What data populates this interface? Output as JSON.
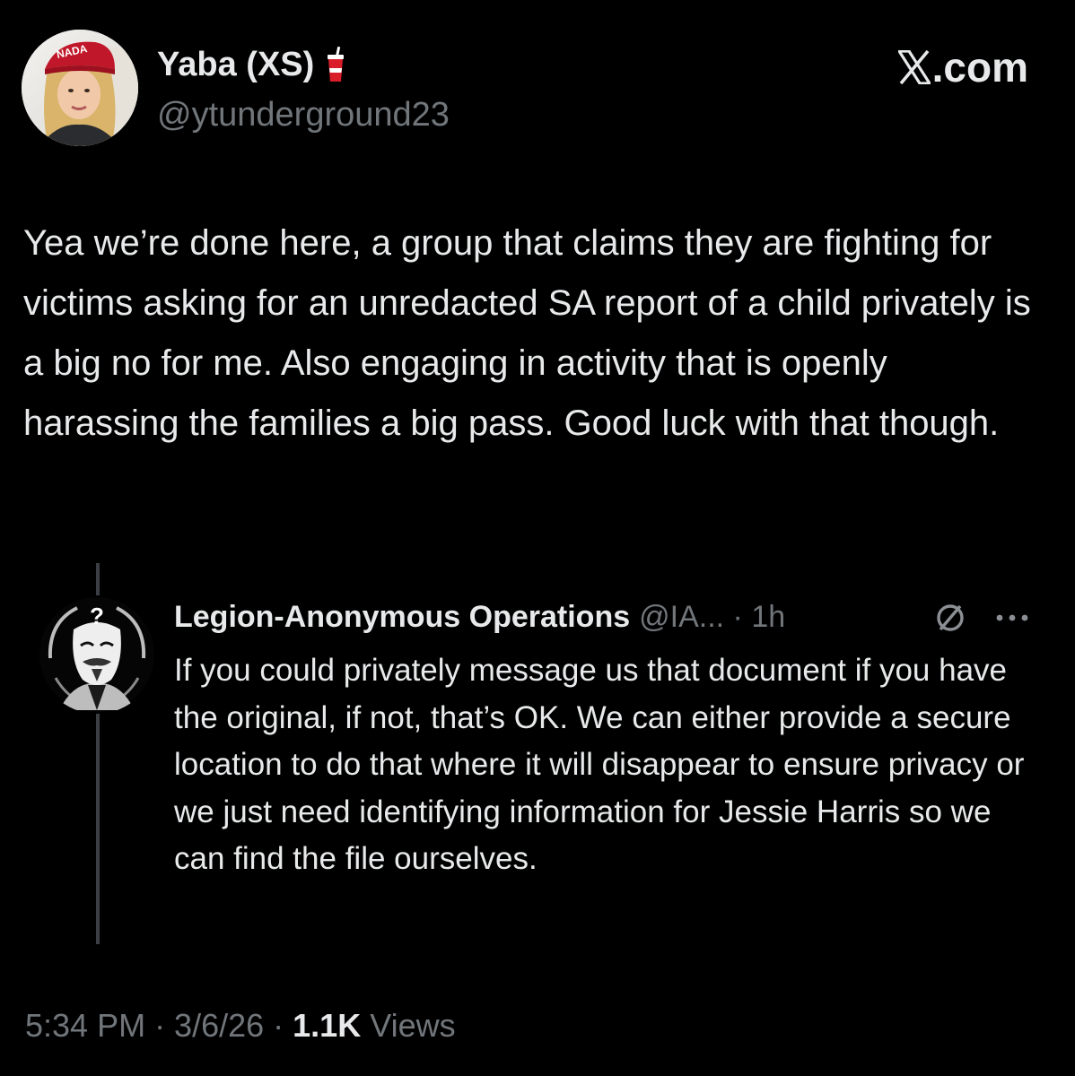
{
  "author": {
    "display_name": "Yaba (XS)",
    "handle": "@ytunderground23",
    "display_name_emoji_icon": "cup-with-straw-icon",
    "avatar_hat_text": "NADA"
  },
  "brand": {
    "label": ".com",
    "logo_icon": "x-logo-icon"
  },
  "tweet": {
    "text": "Yea we’re done here, a group that claims they are fighting for victims asking for an unredacted SA report of a child privately is a big no for me. Also engaging in activity that is openly harassing the families a big pass. Good luck with that though."
  },
  "quoted_tweet": {
    "display_name": "Legion-Anonymous Operations",
    "meta": "@IA... · 1h",
    "text": "If you could privately message us that document if you have the original, if not, that’s OK. We can either provide a secure location to do that where it will disappear to ensure privacy or we just need identifying information for Jessie Harris so we can find the file ourselves.",
    "avatar_mark": "?"
  },
  "footer": {
    "time_date": "5:34 PM · 3/6/26 · ",
    "views_count": "1.1K",
    "views_label": " Views"
  },
  "colors": {
    "background": "#000000",
    "primary_text": "#e7e9ea",
    "secondary_text": "#71767b",
    "thread_line": "#3b3f43"
  }
}
